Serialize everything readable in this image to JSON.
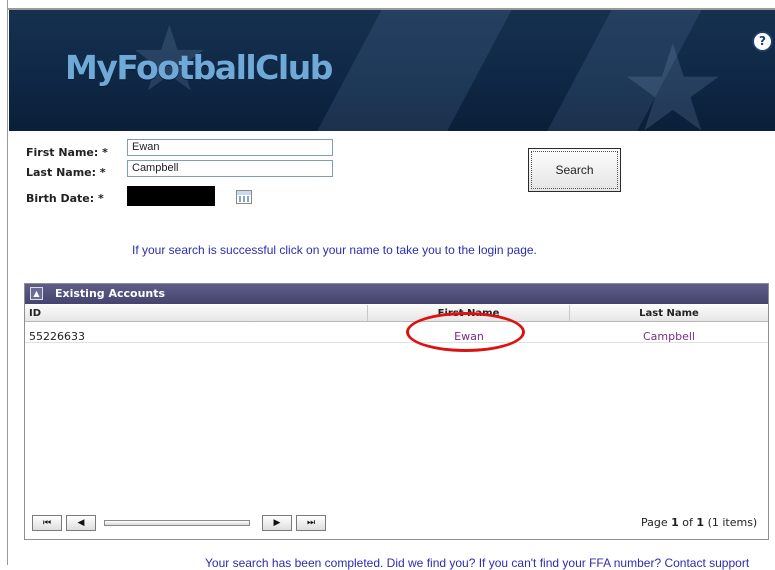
{
  "app": {
    "brand": "MyFootballClub",
    "help_icon": "?"
  },
  "form": {
    "first_name": {
      "label": "First Name: *",
      "value": "Ewan"
    },
    "last_name": {
      "label": "Last Name: *",
      "value": "Campbell"
    },
    "birth_date": {
      "label": "Birth Date: *",
      "value": ""
    },
    "search_label": "Search",
    "hint": "If your search is successful click on your name to take you to the login page."
  },
  "grid": {
    "title": "Existing Accounts",
    "columns": [
      "ID",
      "First Name",
      "Last Name"
    ],
    "rows": [
      {
        "id": "55226633",
        "first": "Ewan",
        "last": "Campbell"
      }
    ],
    "pager": {
      "first": "⏮",
      "prev": "◀",
      "next": "▶",
      "last": "⏭",
      "page_prefix": "Page",
      "page": "1",
      "of": "of",
      "pages": "1",
      "items": "(1 items)"
    }
  },
  "footer": {
    "message": "Your search has been completed. Did we find you? If you can't find your FFA number? Contact support"
  },
  "colors": {
    "banner": "#0f2846",
    "accent_link": "#2c2cb0",
    "grid_header": "#4f4f7a",
    "annotation": "#dd1111"
  }
}
